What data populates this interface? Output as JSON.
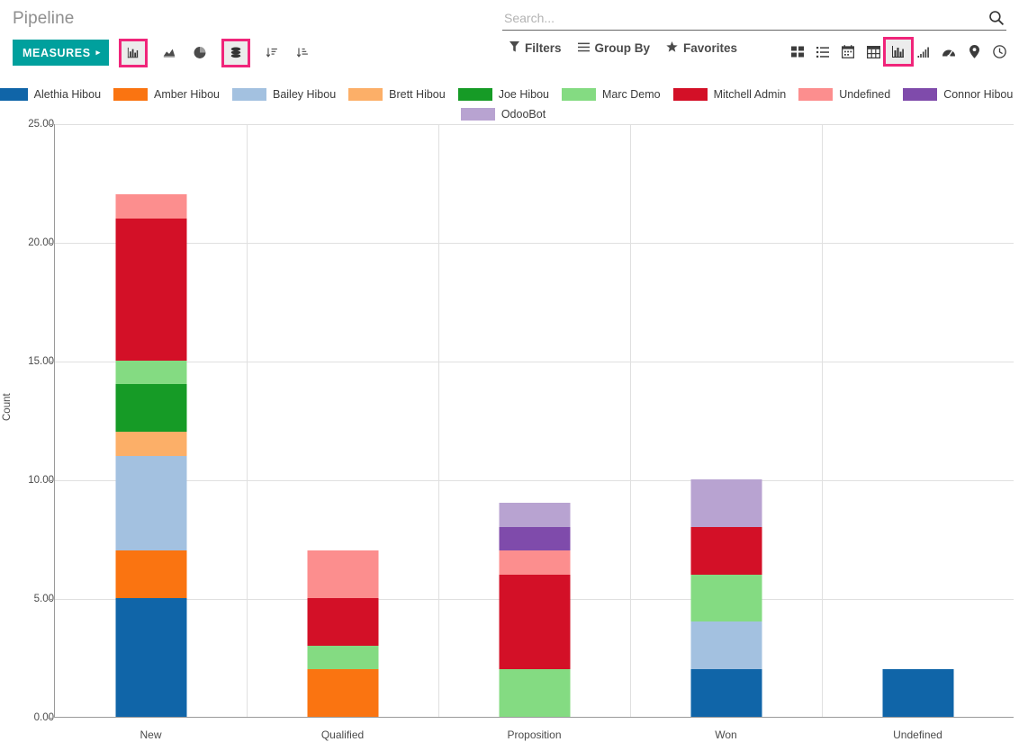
{
  "breadcrumb": "Pipeline",
  "toolbar": {
    "measures_label": "MEASURES",
    "measures_caret": "▸",
    "chart_buttons": [
      {
        "name": "bar-chart-icon",
        "selected": true
      },
      {
        "name": "line-chart-icon",
        "selected": false
      },
      {
        "name": "pie-chart-icon",
        "selected": false
      },
      {
        "name": "stacked-icon",
        "selected": true
      },
      {
        "name": "sort-descending-icon",
        "selected": false
      },
      {
        "name": "sort-ascending-icon",
        "selected": false
      }
    ]
  },
  "search": {
    "placeholder": "Search...",
    "value": "",
    "icon": "search-icon"
  },
  "filter_row": {
    "filters_label": "Filters",
    "group_by_label": "Group By",
    "favorites_label": "Favorites",
    "filters_icon": "funnel-icon",
    "group_by_icon": "hamburger-icon",
    "favorites_icon": "star-icon"
  },
  "view_switcher": {
    "views": [
      {
        "name": "kanban-view-icon",
        "active": false
      },
      {
        "name": "list-view-icon",
        "active": false
      },
      {
        "name": "calendar-view-icon",
        "active": false
      },
      {
        "name": "pivot-view-icon",
        "active": false
      },
      {
        "name": "graph-view-icon",
        "active": true
      },
      {
        "name": "cohort-view-icon",
        "active": false
      },
      {
        "name": "dashboard-view-icon",
        "active": false
      },
      {
        "name": "map-view-icon",
        "active": false
      },
      {
        "name": "activity-view-icon",
        "active": false
      }
    ]
  },
  "colors": {
    "accent_teal": "#00a09d",
    "highlight_pink": "#f0257a",
    "axis": "#9a9a9a",
    "grid": "#e0e0e0"
  },
  "chart_data": {
    "type": "bar",
    "stacked": true,
    "title": "",
    "xlabel": "",
    "ylabel": "Count",
    "ylim": [
      0,
      25
    ],
    "yticks": [
      "0.00",
      "5.00",
      "10.00",
      "15.00",
      "20.00",
      "25.00"
    ],
    "ytick_values": [
      0,
      5,
      10,
      15,
      20,
      25
    ],
    "grid": true,
    "legend_position": "top",
    "categories": [
      "New",
      "Qualified",
      "Proposition",
      "Won",
      "Undefined"
    ],
    "series": [
      {
        "name": "Alethia Hibou",
        "color": "#1065a8",
        "values": [
          5,
          0,
          0,
          2,
          2
        ]
      },
      {
        "name": "Amber Hibou",
        "color": "#fa7411",
        "values": [
          2,
          2,
          0,
          0,
          0
        ]
      },
      {
        "name": "Bailey Hibou",
        "color": "#a3c1e0",
        "values": [
          4,
          0,
          0,
          2,
          0
        ]
      },
      {
        "name": "Brett Hibou",
        "color": "#fcaf68",
        "values": [
          1,
          0,
          0,
          0,
          0
        ]
      },
      {
        "name": "Joe Hibou",
        "color": "#169b26",
        "values": [
          2,
          0,
          0,
          0,
          0
        ]
      },
      {
        "name": "Marc Demo",
        "color": "#84db82",
        "values": [
          1,
          1,
          2,
          2,
          0
        ]
      },
      {
        "name": "Mitchell Admin",
        "color": "#d31027",
        "values": [
          6,
          2,
          4,
          2,
          0
        ]
      },
      {
        "name": "Undefined",
        "color": "#fc8e8e",
        "values": [
          1,
          2,
          1,
          0,
          0
        ]
      },
      {
        "name": "Connor Hibou",
        "color": "#7f4bab",
        "values": [
          0,
          0,
          1,
          0,
          0
        ]
      },
      {
        "name": "OdooBot",
        "color": "#b8a3d1",
        "values": [
          0,
          0,
          1,
          2,
          0
        ]
      }
    ],
    "totals": [
      22,
      7,
      9,
      10,
      2
    ]
  }
}
